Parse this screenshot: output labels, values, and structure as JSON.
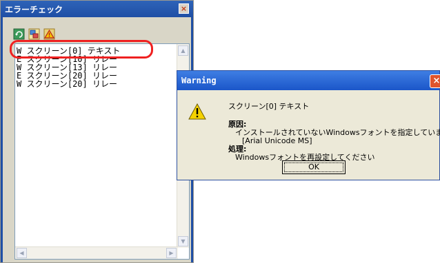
{
  "error_panel": {
    "title": "エラーチェック",
    "close_icon": "×",
    "toolbar": [
      "refresh-icon",
      "jump-icon",
      "warning-filter-icon"
    ],
    "items": [
      "W スクリーン[0] テキスト",
      "E スクリーン[10] リレー",
      "W スクリーン[13] リレー",
      "E スクリーン[20] リレー",
      "W スクリーン[20] リレー"
    ],
    "colors": {
      "titlebar": "#2a5db5",
      "highlight": "#ef2020"
    }
  },
  "dialog": {
    "title": "Warning",
    "close_icon": "×",
    "icon": "warning-icon",
    "subject": "スクリーン[0] テキスト",
    "cause_label": "原因:",
    "cause_text": "インストールされていないWindowsフォントを指定しています。",
    "font_name": "[Arial Unicode MS]",
    "action_label": "処理:",
    "action_text": "Windowsフォントを再設定してください",
    "ok_label": "OK"
  }
}
